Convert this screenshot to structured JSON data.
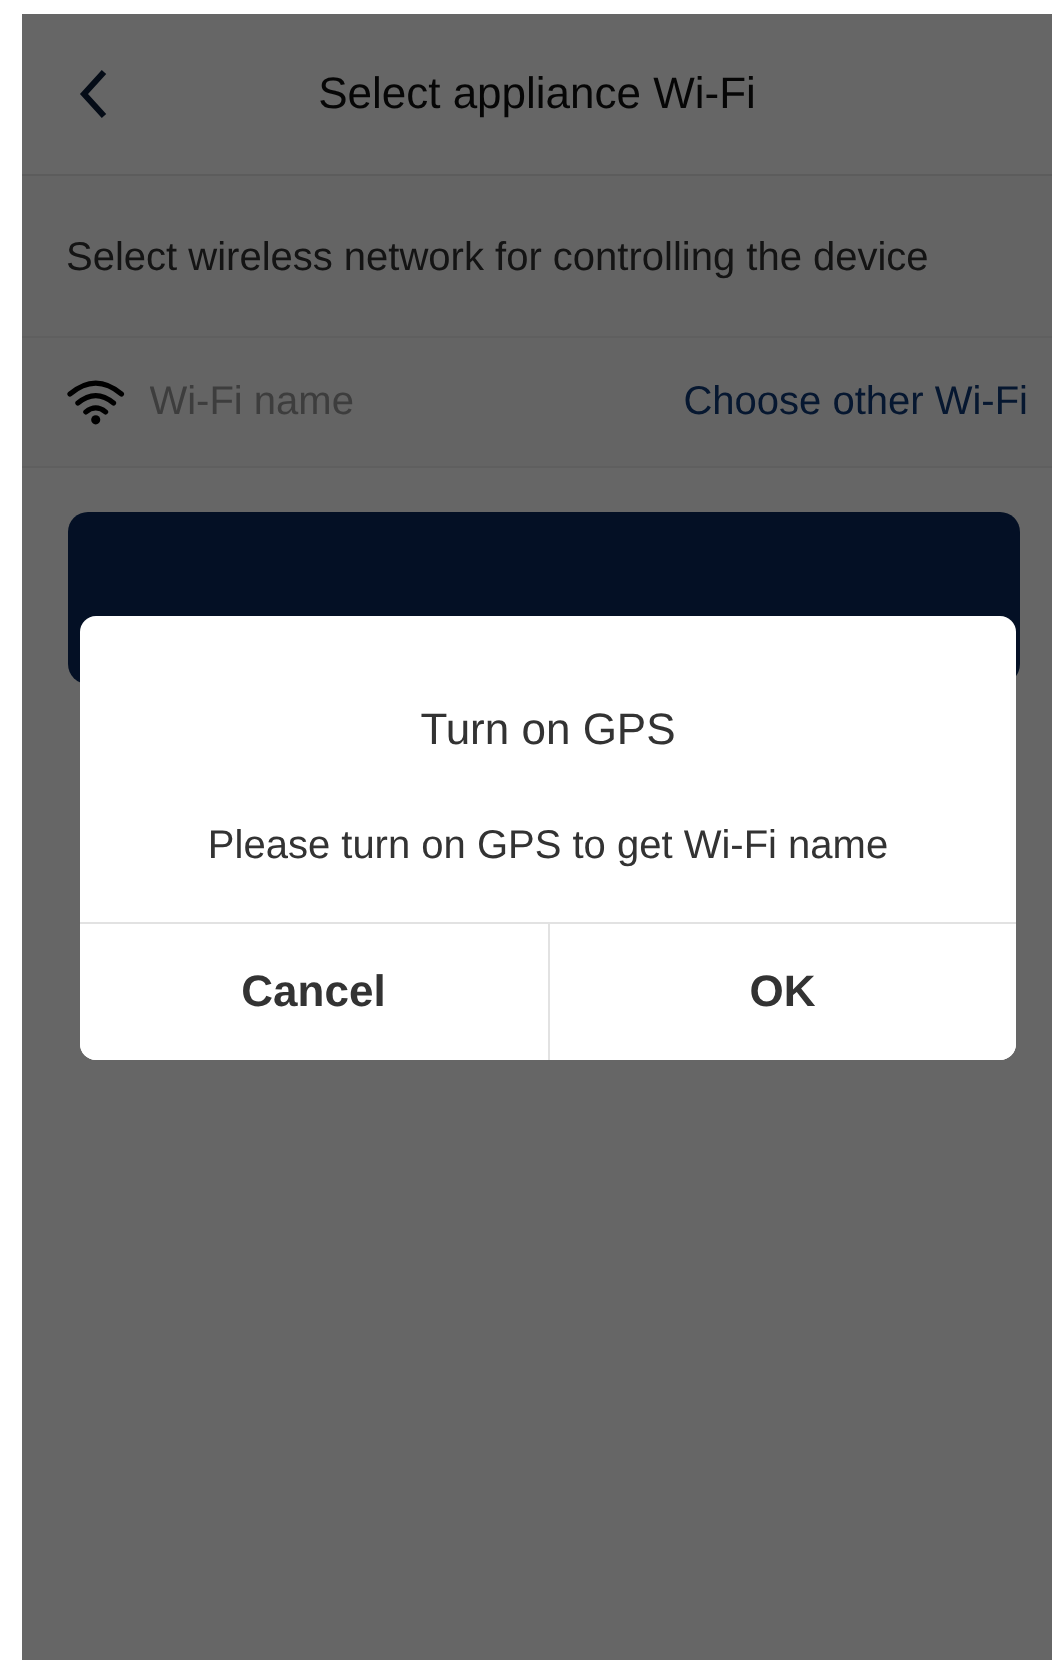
{
  "header": {
    "title": "Select appliance Wi-Fi"
  },
  "description": "Select wireless network for controlling the device",
  "wifi_field": {
    "placeholder": "Wi-Fi name",
    "link": "Choose other Wi-Fi"
  },
  "dialog": {
    "title": "Turn on GPS",
    "message": "Please turn on GPS to get Wi-Fi name",
    "buttons": [
      "Cancel",
      "OK"
    ]
  }
}
